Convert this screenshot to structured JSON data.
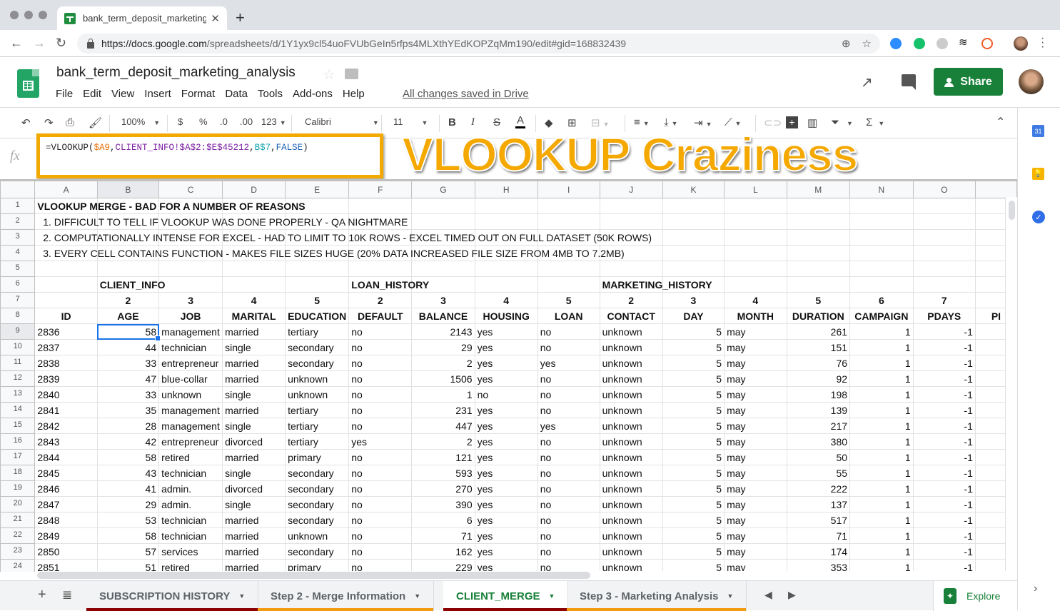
{
  "browser": {
    "tab_title": "bank_term_deposit_marketing_",
    "new_tab": "+",
    "close_tab": "✕",
    "url_host": "https://docs.google.com",
    "url_path": "/spreadsheets/d/1Y1yx9cl54uoFVUbGeIn5rfps4MLXthYEdKOPZqMm190/edit#gid=168832439"
  },
  "app": {
    "doc_title": "bank_term_deposit_marketing_analysis",
    "menu": [
      "File",
      "Edit",
      "View",
      "Insert",
      "Format",
      "Data",
      "Tools",
      "Add-ons",
      "Help"
    ],
    "save_status": "All changes saved in Drive",
    "share_label": "Share"
  },
  "toolbar": {
    "zoom": "100%",
    "currency": "$",
    "percent": "%",
    "dec_decrease": ".0",
    "dec_increase": ".00",
    "more_formats": "123",
    "font": "Calibri",
    "font_size": "11",
    "bold": "B",
    "italic": "I",
    "strike": "S",
    "text_color": "A",
    "sum": "Σ"
  },
  "formula_bar": {
    "fx": "fx",
    "formula_parts": {
      "p1": "=VLOOKUP(",
      "p2": "$A9",
      "p3": ",",
      "p4": "CLIENT_INFO!$A$2:$E$45212",
      "p5": ",",
      "p6": "B$7",
      "p7": ",",
      "p8": "FALSE",
      "p9": ")"
    }
  },
  "overlay_title": "VLOOKUP Craziness",
  "grid": {
    "columns": [
      "A",
      "B",
      "C",
      "D",
      "E",
      "F",
      "G",
      "H",
      "I",
      "J",
      "K",
      "L",
      "M",
      "N",
      "O",
      ""
    ],
    "selected_column": "B",
    "selected_cell": "B9",
    "notes": {
      "r1": "VLOOKUP MERGE - BAD FOR A NUMBER OF REASONS",
      "r2": "  1. DIFFICULT TO TELL IF VLOOKUP WAS DONE PROPERLY - QA NIGHTMARE",
      "r3": "  2. COMPUTATIONALLY INTENSE FOR EXCEL - HAD TO LIMIT TO 10K ROWS - EXCEL TIMED OUT ON FULL DATASET (50K ROWS)",
      "r4": "  3. EVERY CELL CONTAINS FUNCTION - MAKES FILE SIZES HUGE (20% DATA INCREASED FILE SIZE FROM 4MB TO 7.2MB)"
    },
    "groups": {
      "client_info": "CLIENT_INFO",
      "loan_history": "LOAN_HISTORY",
      "marketing_history": "MARKETING_HISTORY"
    },
    "index_row": [
      "",
      "2",
      "3",
      "4",
      "5",
      "2",
      "3",
      "4",
      "5",
      "2",
      "3",
      "4",
      "5",
      "6",
      "7",
      ""
    ],
    "headers": [
      "ID",
      "AGE",
      "JOB",
      "MARITAL",
      "EDUCATION",
      "DEFAULT",
      "BALANCE",
      "HOUSING",
      "LOAN",
      "CONTACT",
      "DAY",
      "MONTH",
      "DURATION",
      "CAMPAIGN",
      "PDAYS",
      "PI"
    ],
    "rows": [
      [
        "2836",
        "58",
        "management",
        "married",
        "tertiary",
        "no",
        "2143",
        "yes",
        "no",
        "unknown",
        "5",
        "may",
        "261",
        "1",
        "-1"
      ],
      [
        "2837",
        "44",
        "technician",
        "single",
        "secondary",
        "no",
        "29",
        "yes",
        "no",
        "unknown",
        "5",
        "may",
        "151",
        "1",
        "-1"
      ],
      [
        "2838",
        "33",
        "entrepreneur",
        "married",
        "secondary",
        "no",
        "2",
        "yes",
        "yes",
        "unknown",
        "5",
        "may",
        "76",
        "1",
        "-1"
      ],
      [
        "2839",
        "47",
        "blue-collar",
        "married",
        "unknown",
        "no",
        "1506",
        "yes",
        "no",
        "unknown",
        "5",
        "may",
        "92",
        "1",
        "-1"
      ],
      [
        "2840",
        "33",
        "unknown",
        "single",
        "unknown",
        "no",
        "1",
        "no",
        "no",
        "unknown",
        "5",
        "may",
        "198",
        "1",
        "-1"
      ],
      [
        "2841",
        "35",
        "management",
        "married",
        "tertiary",
        "no",
        "231",
        "yes",
        "no",
        "unknown",
        "5",
        "may",
        "139",
        "1",
        "-1"
      ],
      [
        "2842",
        "28",
        "management",
        "single",
        "tertiary",
        "no",
        "447",
        "yes",
        "yes",
        "unknown",
        "5",
        "may",
        "217",
        "1",
        "-1"
      ],
      [
        "2843",
        "42",
        "entrepreneur",
        "divorced",
        "tertiary",
        "yes",
        "2",
        "yes",
        "no",
        "unknown",
        "5",
        "may",
        "380",
        "1",
        "-1"
      ],
      [
        "2844",
        "58",
        "retired",
        "married",
        "primary",
        "no",
        "121",
        "yes",
        "no",
        "unknown",
        "5",
        "may",
        "50",
        "1",
        "-1"
      ],
      [
        "2845",
        "43",
        "technician",
        "single",
        "secondary",
        "no",
        "593",
        "yes",
        "no",
        "unknown",
        "5",
        "may",
        "55",
        "1",
        "-1"
      ],
      [
        "2846",
        "41",
        "admin.",
        "divorced",
        "secondary",
        "no",
        "270",
        "yes",
        "no",
        "unknown",
        "5",
        "may",
        "222",
        "1",
        "-1"
      ],
      [
        "2847",
        "29",
        "admin.",
        "single",
        "secondary",
        "no",
        "390",
        "yes",
        "no",
        "unknown",
        "5",
        "may",
        "137",
        "1",
        "-1"
      ],
      [
        "2848",
        "53",
        "technician",
        "married",
        "secondary",
        "no",
        "6",
        "yes",
        "no",
        "unknown",
        "5",
        "may",
        "517",
        "1",
        "-1"
      ],
      [
        "2849",
        "58",
        "technician",
        "married",
        "unknown",
        "no",
        "71",
        "yes",
        "no",
        "unknown",
        "5",
        "may",
        "71",
        "1",
        "-1"
      ],
      [
        "2850",
        "57",
        "services",
        "married",
        "secondary",
        "no",
        "162",
        "yes",
        "no",
        "unknown",
        "5",
        "may",
        "174",
        "1",
        "-1"
      ],
      [
        "2851",
        "51",
        "retired",
        "married",
        "primary",
        "no",
        "229",
        "yes",
        "no",
        "unknown",
        "5",
        "may",
        "353",
        "1",
        "-1"
      ]
    ]
  },
  "sheet_tabs": [
    {
      "label": "SUBSCRIPTION HISTORY",
      "color": "#8b0000",
      "active": false
    },
    {
      "label": "Step 2 - Merge Information",
      "color": "#f39c12",
      "active": false
    },
    {
      "label": "CLIENT_MERGE",
      "color": "#8b0000",
      "active": true
    },
    {
      "label": "Step 3 - Marketing Analysis",
      "color": "#f39c12",
      "active": false
    }
  ],
  "explore_label": "Explore",
  "side_panel": {
    "calendar_label": "31"
  },
  "colors": {
    "share_green": "#188038",
    "highlight_orange": "#f2a900",
    "selection_blue": "#1a73e8"
  }
}
